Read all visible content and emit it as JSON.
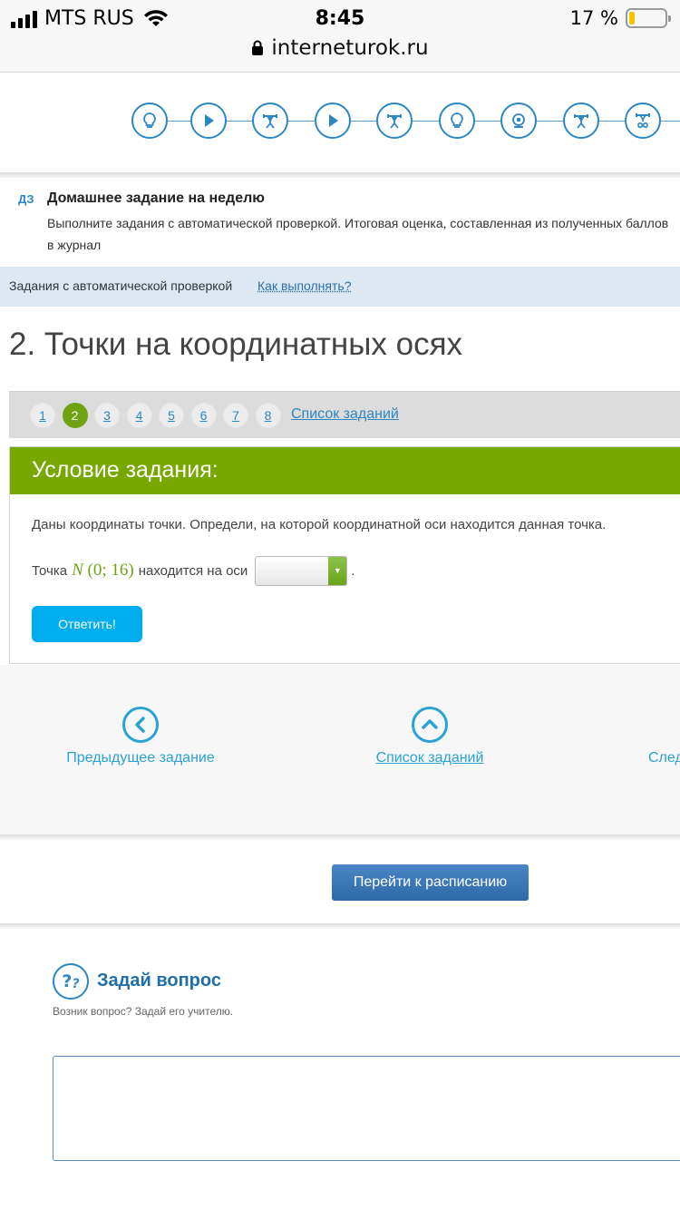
{
  "status_bar": {
    "carrier": "MTS RUS",
    "time": "8:45",
    "battery": "17 %",
    "battery_level": 0.17
  },
  "browser": {
    "url": "interneturok.ru"
  },
  "lesson_steps": [
    {
      "icon": "lightbulb-icon"
    },
    {
      "icon": "play-icon"
    },
    {
      "icon": "weightlifter-icon"
    },
    {
      "icon": "play-icon"
    },
    {
      "icon": "weightlifter-icon"
    },
    {
      "icon": "lightbulb-icon"
    },
    {
      "icon": "webcam-icon"
    },
    {
      "icon": "weightlifter-icon"
    },
    {
      "icon": "weightlifter-infinity-icon"
    }
  ],
  "homework": {
    "tag": "ДЗ",
    "title": "Домашнее задание на неделю",
    "text": "Выполните задания с автоматической проверкой. Итоговая оценка, составленная из полученных баллов",
    "text2": "в журнал"
  },
  "auto_check": {
    "label": "Задания с автоматической проверкой",
    "how_link": "Как выполнять?"
  },
  "page_title": "2. Точки на координатных осях",
  "pager": {
    "numbers": [
      "1",
      "2",
      "3",
      "4",
      "5",
      "6",
      "7",
      "8"
    ],
    "active": "2",
    "list_link": "Список заданий"
  },
  "task": {
    "header": "Условие задания:",
    "condition": "Даны координаты точки. Определи, на которой координатной оси находится данная точка.",
    "q_prefix": "Точка",
    "point_name": "N",
    "point_coords": "(0; 16)",
    "q_suffix": "находится на оси",
    "period": ".",
    "select_value": "",
    "answer_button": "Ответить!"
  },
  "navigation": {
    "prev": "Предыдущее задание",
    "list": "Список заданий",
    "next": "Следующее задание"
  },
  "schedule_button": "Перейти к расписанию",
  "ask": {
    "icon_text": "?ₚ",
    "title": "Задай вопрос",
    "subtitle": "Возник вопрос? Задай его учителю.",
    "placeholder": ""
  }
}
